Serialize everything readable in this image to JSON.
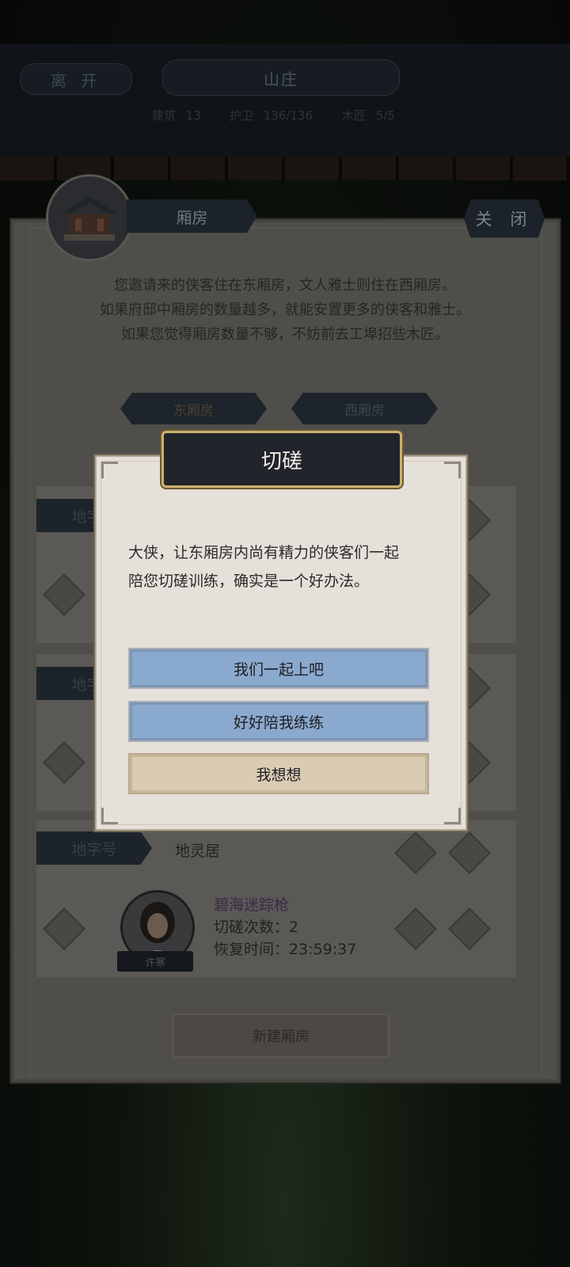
{
  "top": {
    "leave_label": "离 开",
    "estate_title": "山庄",
    "building_label": "建筑",
    "building_value": "13",
    "guards_label": "护卫",
    "guards_value": "136/136",
    "carpenter_label": "木匠",
    "carpenter_value": "5/5"
  },
  "panel": {
    "section_tag": "厢房",
    "close_label": "关 闭",
    "intro_lines": [
      "您邀请来的侠客住在东厢房，文人雅士则住在西厢房。",
      "如果府邸中厢房的数量越多，就能安置更多的侠客和雅士。",
      "如果您觉得厢房数量不够，不妨前去工埠招些木匠。"
    ],
    "tab_east": "东厢房",
    "tab_west": "西厢房",
    "room_tag": "地字号",
    "room_name": "地灵居",
    "hero": {
      "technique": "碧海迷踪枪",
      "spar_label": "切磋次数：",
      "spar_value": "2",
      "recover_label": "恢复时间：",
      "recover_value": "23:59:37",
      "name": "许寒"
    },
    "new_room_label": "新建厢房"
  },
  "dialog": {
    "title": "切磋",
    "message_line1": "大侠，让东厢房内尚有精力的侠客们一起",
    "message_line2": "陪您切磋训练，确实是一个好办法。",
    "options": [
      "我们一起上吧",
      "好好陪我练练",
      "我想想"
    ]
  }
}
